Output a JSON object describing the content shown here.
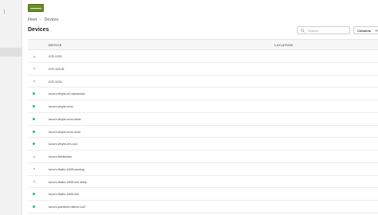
{
  "sidebar": {
    "collapse_icon": "vertical-dots-icon"
  },
  "header": {
    "logo_icon": "company-logo"
  },
  "breadcrumb": {
    "root": "Fleet",
    "current": "Devices"
  },
  "page": {
    "title": "Devices"
  },
  "search": {
    "placeholder": "Search",
    "value": ""
  },
  "columns_button": {
    "label": "Columns"
  },
  "table": {
    "columns": [
      "DEVICE",
      "LOCATION"
    ],
    "rows": [
      {
        "name": "ICR-2431",
        "status": "offline",
        "location": ""
      },
      {
        "name": "ICR-3211B",
        "status": "offline",
        "location": ""
      },
      {
        "name": "ICR-3231",
        "status": "offline",
        "location": ""
      },
      {
        "name": "lucom-ebyte-e9-ultrasonic",
        "status": "online",
        "location": ""
      },
      {
        "name": "lucom-ebyte-emo",
        "status": "online",
        "location": ""
      },
      {
        "name": "lucom-ebyte-emo-desk",
        "status": "online",
        "location": ""
      },
      {
        "name": "lucom-ebyte-emo-door",
        "status": "online",
        "location": ""
      },
      {
        "name": "lucom-ebyte-ers-co2",
        "status": "online",
        "location": ""
      },
      {
        "name": "lucom-fieldtester",
        "status": "offline",
        "location": ""
      },
      {
        "name": "lucom-iballo-1608-analog",
        "status": "offline",
        "location": ""
      },
      {
        "name": "lucom-iballo-1608-ext-temp",
        "status": "offline",
        "location": ""
      },
      {
        "name": "lucom-iballo-1608-full",
        "status": "online",
        "location": ""
      },
      {
        "name": "lucom-panteum-fabric-co2",
        "status": "online",
        "location": ""
      }
    ]
  },
  "colors": {
    "online": "#2bb673",
    "offline": "#a8a8a8",
    "logo": "#6b8e23"
  }
}
